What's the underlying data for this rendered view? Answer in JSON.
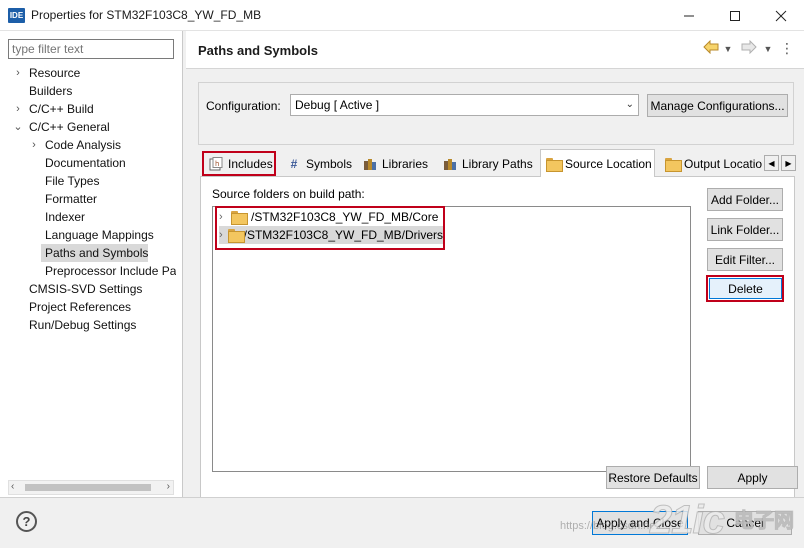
{
  "window": {
    "app_icon": "IDE",
    "title": "Properties for STM32F103C8_YW_FD_MB",
    "minimize_icon": "minimize-icon",
    "maximize_icon": "maximize-icon",
    "close_icon": "close-icon"
  },
  "filter": {
    "placeholder": "type filter text"
  },
  "tree": [
    {
      "label": "Resource",
      "expander": "›"
    },
    {
      "label": "Builders",
      "expander": ""
    },
    {
      "label": "C/C++ Build",
      "expander": "›"
    },
    {
      "label": "C/C++ General",
      "expander": "⌄"
    },
    {
      "label": "Code Analysis",
      "expander": "›"
    },
    {
      "label": "Documentation",
      "expander": ""
    },
    {
      "label": "File Types",
      "expander": ""
    },
    {
      "label": "Formatter",
      "expander": ""
    },
    {
      "label": "Indexer",
      "expander": ""
    },
    {
      "label": "Language Mappings",
      "expander": ""
    },
    {
      "label": "Paths and Symbols",
      "expander": "",
      "selected": true
    },
    {
      "label": "Preprocessor Include Pat",
      "expander": ""
    },
    {
      "label": "CMSIS-SVD Settings",
      "expander": ""
    },
    {
      "label": "Project References",
      "expander": ""
    },
    {
      "label": "Run/Debug Settings",
      "expander": ""
    }
  ],
  "page": {
    "title": "Paths and Symbols"
  },
  "configuration": {
    "label": "Configuration:",
    "value": "Debug  [ Active ]",
    "manage_button": "Manage Configurations..."
  },
  "tabs": [
    {
      "label": "Includes",
      "icon": "includes-icon"
    },
    {
      "label": "Symbols",
      "icon": "hash-icon"
    },
    {
      "label": "Libraries",
      "icon": "libraries-icon"
    },
    {
      "label": "Library Paths",
      "icon": "library-paths-icon"
    },
    {
      "label": "Source Location",
      "icon": "folder-icon",
      "active": true
    },
    {
      "label": "Output Locatio",
      "icon": "output-folder-icon"
    }
  ],
  "source": {
    "label": "Source folders on build path:",
    "folders": [
      "/STM32F103C8_YW_FD_MB/Core",
      "/STM32F103C8_YW_FD_MB/Drivers"
    ]
  },
  "side_buttons": {
    "add_folder": "Add Folder...",
    "link_folder": "Link Folder...",
    "edit_filter": "Edit Filter...",
    "delete": "Delete"
  },
  "buttons": {
    "restore_defaults": "Restore Defaults",
    "apply": "Apply",
    "apply_and_close": "Apply and Close",
    "cancel": "Cancel"
  },
  "watermark": {
    "url": "https://blog.csdn.net/...",
    "brand": "21ic",
    "site": "电子网"
  },
  "colors": {
    "highlight_box": "#c0001a",
    "selection": "#d9d9d9",
    "folder": "#f3c65f"
  }
}
